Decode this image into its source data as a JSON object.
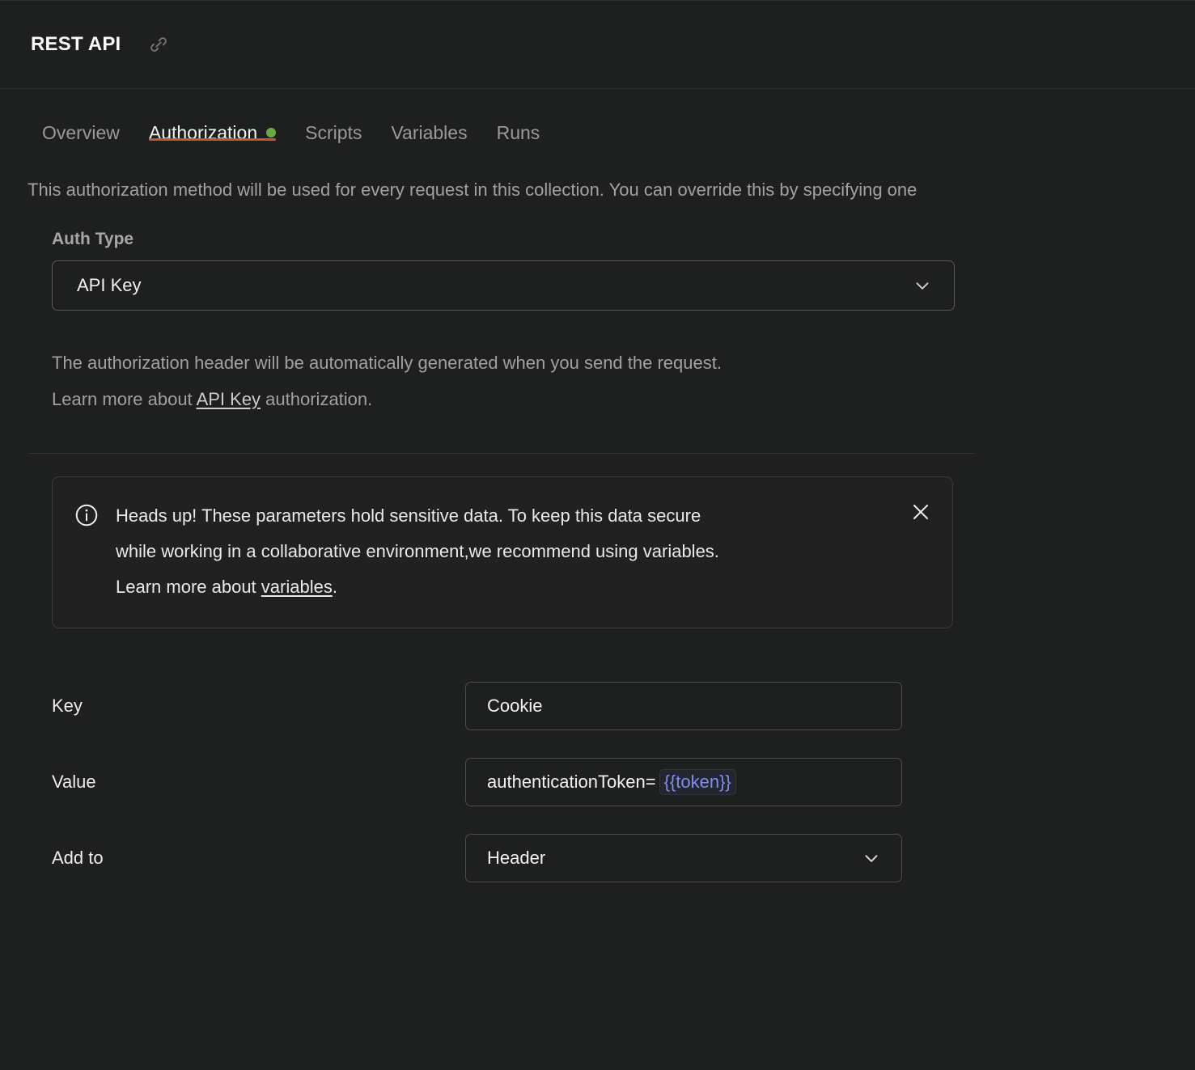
{
  "header": {
    "collection_title": "REST API",
    "link_icon": "link-icon"
  },
  "tabs": [
    {
      "label": "Overview",
      "active": false,
      "dot": false
    },
    {
      "label": "Authorization",
      "active": true,
      "dot": true
    },
    {
      "label": "Scripts",
      "active": false,
      "dot": false
    },
    {
      "label": "Variables",
      "active": false,
      "dot": false
    },
    {
      "label": "Runs",
      "active": false,
      "dot": false
    }
  ],
  "intro": {
    "text": "This authorization method will be used for every request in this collection. You can override this by specifying one"
  },
  "auth_type": {
    "label": "Auth Type",
    "selected": "API Key",
    "chevron_icon": "chevron-down-icon"
  },
  "helper": {
    "line1": "The authorization header will be automatically generated when you send the request.",
    "line2_prefix": "Learn more about ",
    "line2_link": "API Key",
    "line2_suffix": " authorization."
  },
  "banner": {
    "info_icon": "info-circle-icon",
    "close_icon": "close-icon",
    "line1": "Heads up! These parameters hold sensitive data. To keep this data secure",
    "line2": "while working in a collaborative environment,we recommend using variables.",
    "line3_prefix": "Learn more about ",
    "line3_link": "variables",
    "line3_suffix": "."
  },
  "params": {
    "key": {
      "label": "Key",
      "value": "Cookie"
    },
    "value": {
      "label": "Value",
      "value_prefix": "authenticationToken=",
      "value_variable": "{{token}}"
    },
    "add_to": {
      "label": "Add to",
      "selected": "Header",
      "chevron_icon": "chevron-down-icon"
    }
  },
  "colors": {
    "background": "#1e1f1f",
    "accent_tab_underline": "#c15b2e",
    "status_dot_green": "#6ba945",
    "variable_blue": "#7f8cf0",
    "muted_text": "#a3a19e"
  }
}
